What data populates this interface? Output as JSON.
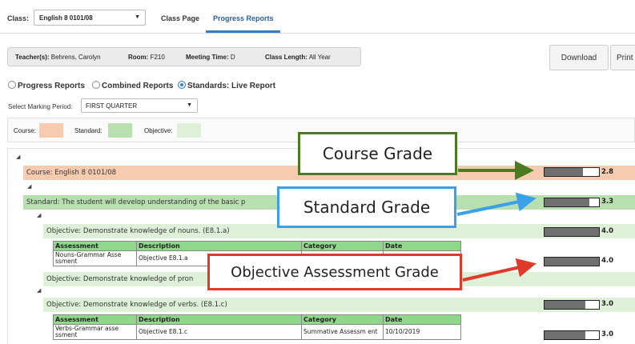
{
  "header": {
    "class_label": "Class:",
    "class_value": "English 8 0101/08",
    "tabs": [
      {
        "label": "Class Page"
      },
      {
        "label": "Progress Reports"
      }
    ]
  },
  "info": {
    "teacher_label": "Teacher(s):",
    "teacher_value": "Behrens, Carolyn",
    "room_label": "Room:",
    "room_value": "F210",
    "meeting_label": "Meeting Time:",
    "meeting_value": "D",
    "length_label": "Class Length:",
    "length_value": "All Year"
  },
  "actions": {
    "download_label": "Download",
    "print_label": "Print"
  },
  "report_types": [
    {
      "label": "Progress Reports",
      "selected": false
    },
    {
      "label": "Combined Reports",
      "selected": false
    },
    {
      "label": "Standards: Live Report",
      "selected": true
    }
  ],
  "marking_period": {
    "label": "Select Marking Period:",
    "value": "FIRST QUARTER"
  },
  "legend": {
    "course_label": "Course:",
    "standard_label": "Standard:",
    "objective_label": "Objective:",
    "colors": {
      "course": "#f7cbb0",
      "standard": "#b8dfb0",
      "objective": "#dff0d8"
    }
  },
  "report": {
    "course": {
      "text": "Course: English 8 0101/08",
      "grade": "2.8",
      "grade_fraction": 0.7
    },
    "standard": {
      "text": "Standard: The student will develop understanding of the basic p",
      "grade": "3.3",
      "grade_fraction": 0.825
    },
    "objectives": [
      {
        "text": "Objective: Demonstrate knowledge of nouns. (E8.1.a)",
        "grade": "4.0",
        "grade_fraction": 1.0
      },
      {
        "text": "Objective: Demonstrate knowledge of pron",
        "grade": "",
        "grade_fraction": 0
      },
      {
        "text": "Objective: Demonstrate knowledge of verbs. (E8.1.c)",
        "grade": "3.0",
        "grade_fraction": 0.75
      }
    ],
    "table_headers": [
      "Assessment",
      "Description",
      "Category",
      "Date"
    ],
    "table_nouns": {
      "assessment": "Nouns-Grammar Asse ssment",
      "description": "Objective E8.1.a",
      "category": "",
      "date": "",
      "grade": "4.0",
      "grade_fraction": 1.0
    },
    "table_verbs": {
      "assessment": "Verbs-Grammar asse ssment",
      "description": "Objective E8.1.c",
      "category": "Summative Assessm ent",
      "date": "10/10/2019",
      "grade": "3.0",
      "grade_fraction": 0.75
    }
  },
  "callouts": {
    "course": "Course Grade",
    "standard": "Standard Grade",
    "objective": "Objective Assessment Grade",
    "colors": {
      "course": "#4a7a22",
      "standard": "#3aa0e8",
      "objective": "#e03a2a"
    }
  }
}
